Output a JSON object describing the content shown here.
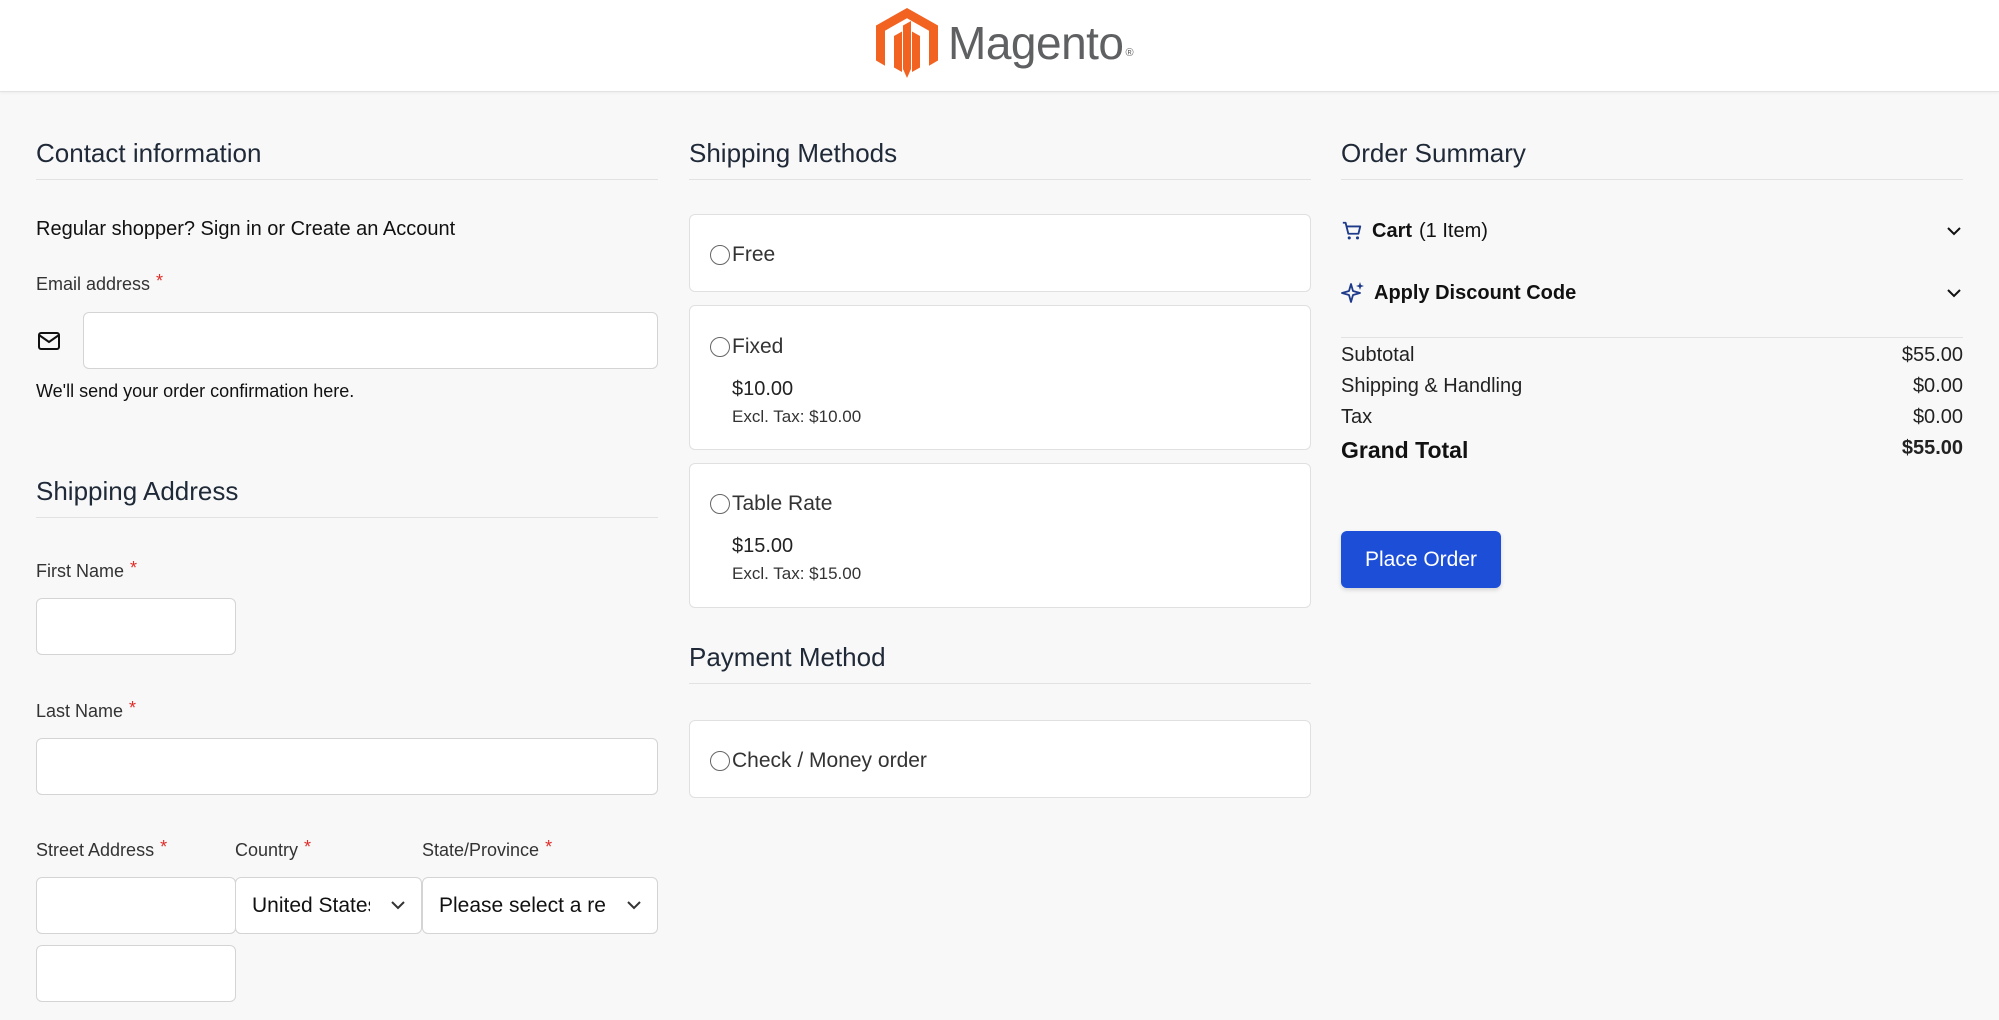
{
  "header": {
    "logo_text": "Magento",
    "logo_reg": "®",
    "brand_color": "#f26322"
  },
  "contact": {
    "title": "Contact information",
    "signin_text": "Regular shopper? Sign in or Create an Account",
    "email_label": "Email address",
    "required_mark": "*",
    "email_value": "",
    "email_help": "We'll send your order confirmation here."
  },
  "shipping_address": {
    "title": "Shipping Address",
    "first_name_label": "First Name",
    "last_name_label": "Last Name",
    "street_label": "Street Address",
    "country_label": "Country",
    "state_label": "State/Province",
    "country_value": "United States",
    "state_value": "Please select a region"
  },
  "shipping_methods": {
    "title": "Shipping Methods",
    "options": [
      {
        "label": "Free"
      },
      {
        "label": "Fixed",
        "price": "$10.00",
        "excl": "Excl. Tax: $10.00"
      },
      {
        "label": "Table Rate",
        "price": "$15.00",
        "excl": "Excl. Tax: $15.00"
      }
    ]
  },
  "payment": {
    "title": "Payment Method",
    "options": [
      {
        "label": "Check / Money order"
      }
    ]
  },
  "summary": {
    "title": "Order Summary",
    "cart_label": "Cart",
    "cart_count": "(1 Item)",
    "discount_label": "Apply Discount Code",
    "rows": [
      {
        "label": "Subtotal",
        "value": "$55.00"
      },
      {
        "label": "Shipping & Handling",
        "value": "$0.00"
      },
      {
        "label": "Tax",
        "value": "$0.00"
      }
    ],
    "grand_label": "Grand Total",
    "grand_value": "$55.00",
    "place_order": "Place Order",
    "accent_color": "#1d4ed8"
  },
  "icons": {
    "mail": "envelope-icon",
    "cart": "cart-icon",
    "discount": "sparkle-icon",
    "chevron": "chevron-down-icon"
  }
}
